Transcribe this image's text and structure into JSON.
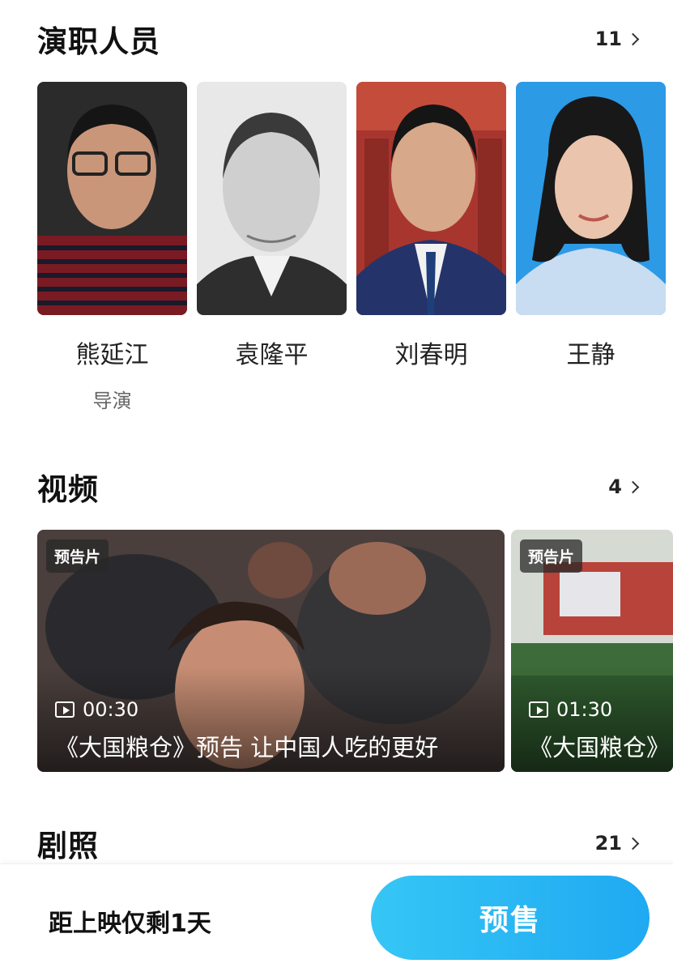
{
  "cast": {
    "title": "演职人员",
    "count": "11",
    "members": [
      {
        "name": "熊延江",
        "role": "导演"
      },
      {
        "name": "袁隆平",
        "role": ""
      },
      {
        "name": "刘春明",
        "role": ""
      },
      {
        "name": "王静",
        "role": ""
      }
    ]
  },
  "videos": {
    "title": "视频",
    "count": "4",
    "items": [
      {
        "tag": "预告片",
        "duration": "00:30",
        "title": "《大国粮仓》预告 让中国人吃的更好"
      },
      {
        "tag": "预告片",
        "duration": "01:30",
        "title": "《大国粮仓》"
      }
    ]
  },
  "stills": {
    "title": "剧照",
    "count": "21"
  },
  "bottom_bar": {
    "countdown": "距上映仅剩1天",
    "presale_label": "预售"
  },
  "colors": {
    "accent": "#29b8f4",
    "text": "#111111",
    "muted": "#666666"
  }
}
